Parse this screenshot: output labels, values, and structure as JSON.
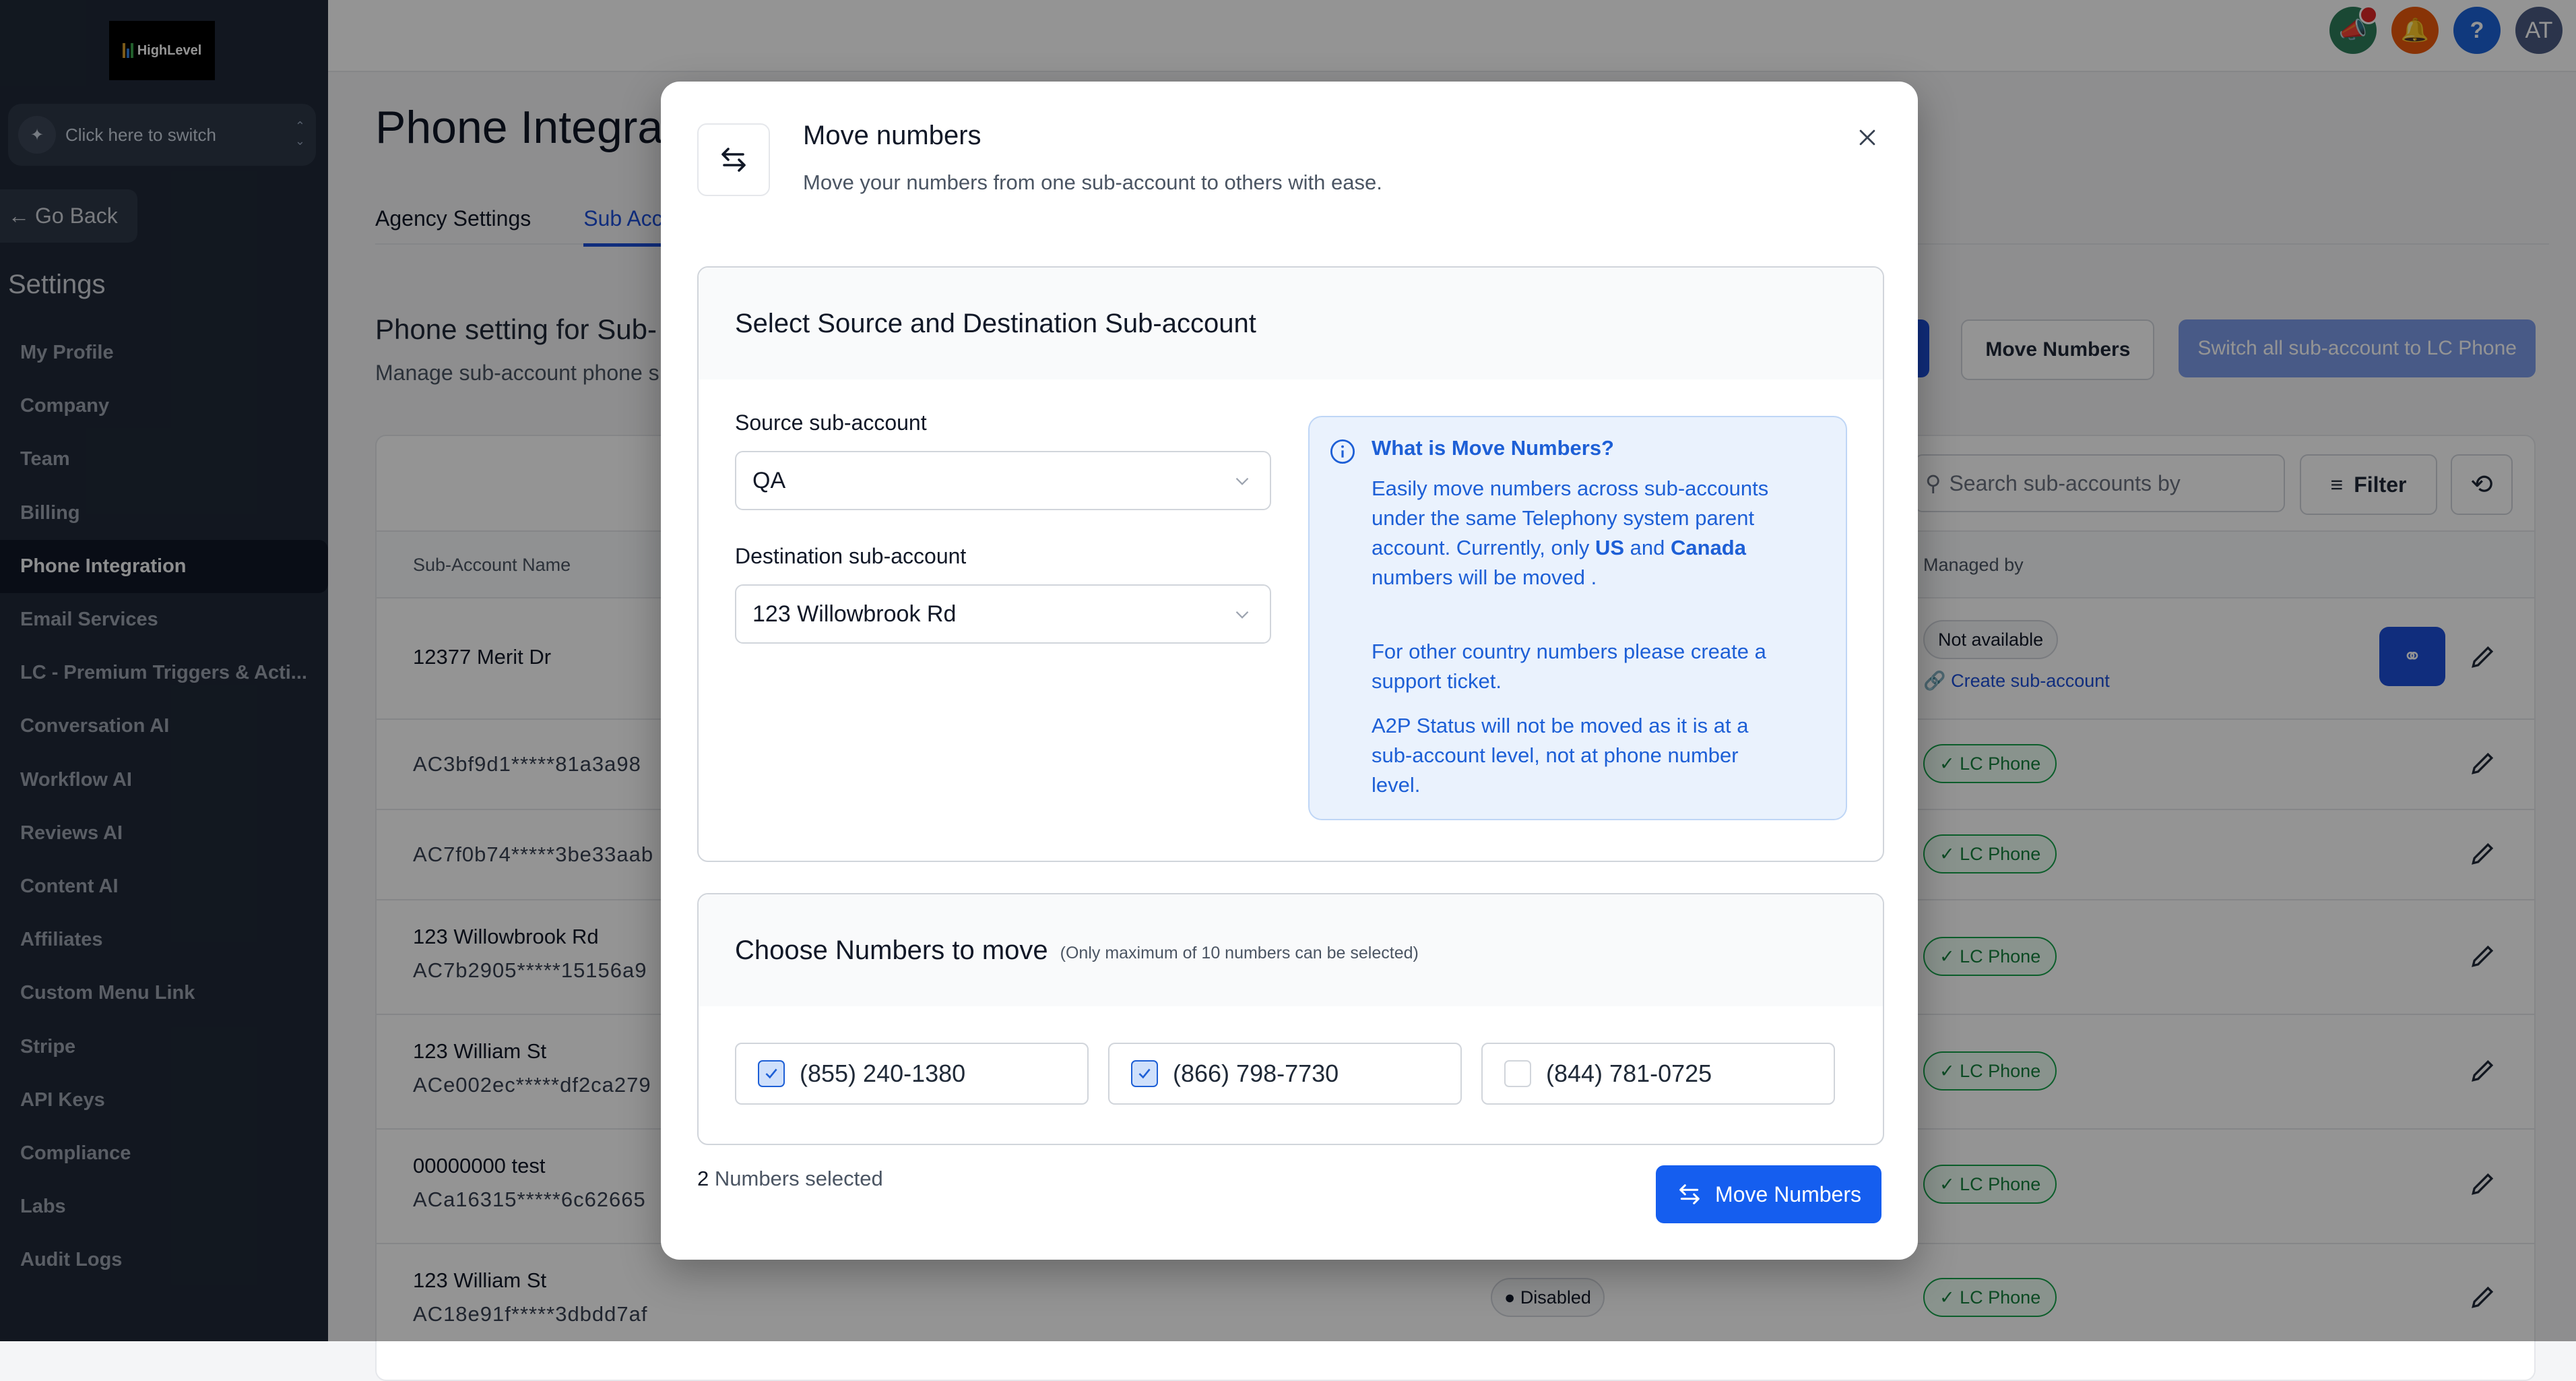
{
  "sidebar": {
    "logo_text": "HighLevel",
    "switcher_label": "Click here to switch",
    "go_back": "Go Back",
    "heading": "Settings",
    "items": [
      {
        "label": "My Profile",
        "active": false
      },
      {
        "label": "Company",
        "active": false
      },
      {
        "label": "Team",
        "active": false
      },
      {
        "label": "Billing",
        "active": false
      },
      {
        "label": "Phone Integration",
        "active": true
      },
      {
        "label": "Email Services",
        "active": false
      },
      {
        "label": "LC - Premium Triggers & Acti...",
        "active": false
      },
      {
        "label": "Conversation AI",
        "active": false
      },
      {
        "label": "Workflow AI",
        "active": false
      },
      {
        "label": "Reviews AI",
        "active": false
      },
      {
        "label": "Content AI",
        "active": false
      },
      {
        "label": "Affiliates",
        "active": false
      },
      {
        "label": "Custom Menu Link",
        "active": false
      },
      {
        "label": "Stripe",
        "active": false
      },
      {
        "label": "API Keys",
        "active": false
      },
      {
        "label": "Compliance",
        "active": false
      },
      {
        "label": "Labs",
        "active": false
      },
      {
        "label": "Audit Logs",
        "active": false
      }
    ]
  },
  "topbar": {
    "icons": [
      {
        "name": "megaphone-icon",
        "color": "#2e7d5b",
        "badge": true
      },
      {
        "name": "bell-icon",
        "color": "#ea580c",
        "badge": false
      },
      {
        "name": "help-icon",
        "color": "#1d63d8",
        "badge": false
      },
      {
        "name": "avatar",
        "color": "#4a5b82",
        "text": "AT"
      }
    ]
  },
  "page": {
    "title": "Phone Integra",
    "tabs": [
      {
        "label": "Agency Settings",
        "active": false
      },
      {
        "label": "Sub Acco",
        "active": true
      }
    ],
    "section_title": "Phone setting for Sub-",
    "section_desc": "Manage sub-account phone s",
    "buttons": {
      "move_numbers": "Move Numbers",
      "switch_all": "Switch all sub-account to LC Phone"
    },
    "search_placeholder": "Search sub-accounts by",
    "filter_label": "Filter",
    "table": {
      "headers": {
        "name": "Sub-Account Name",
        "managed_by": "Managed by"
      },
      "rows": [
        {
          "name": "12377 Merit Dr",
          "sid": "",
          "status": "",
          "managed": "Not available",
          "link": "Create sub-account"
        },
        {
          "name": "",
          "sid": "AC3bf9d1*****81a3a98",
          "status": "",
          "managed": "LC Phone"
        },
        {
          "name": "",
          "sid": "AC7f0b74*****3be33aab",
          "status": "",
          "managed": "LC Phone"
        },
        {
          "name": "123 Willowbrook Rd",
          "sid": "AC7b2905*****15156a9",
          "status": "",
          "managed": "LC Phone"
        },
        {
          "name": "123 William St",
          "sid": "ACe002ec*****df2ca279",
          "status": "",
          "managed": "LC Phone"
        },
        {
          "name": "00000000 test",
          "sid": "ACa16315*****6c62665",
          "status": "",
          "managed": "LC Phone"
        },
        {
          "name": "123 William St",
          "sid": "AC18e91f*****3dbdd7af",
          "status": "Disabled",
          "managed": "LC Phone"
        }
      ]
    }
  },
  "modal": {
    "title": "Move numbers",
    "subtitle": "Move your numbers from one sub-account to others with ease.",
    "source_section": {
      "title": "Select Source and Destination Sub-account",
      "source_label": "Source sub-account",
      "source_value": "QA",
      "dest_label": "Destination sub-account",
      "dest_value": "123 Willowbrook Rd"
    },
    "info": {
      "title": "What is Move Numbers?",
      "p1_a": "Easily move numbers across sub-accounts under the same Telephony system parent account. Currently, only ",
      "p1_us": "US",
      "p1_and": " and ",
      "p1_ca": "Canada",
      "p1_b": " numbers will be moved .",
      "p2": "For other country numbers please create a support ticket.",
      "p3": "A2P Status will not be moved as it is at a sub-account level, not at phone number level."
    },
    "numbers_section": {
      "title": "Choose Numbers to move",
      "note": "(Only maximum of 10 numbers can be selected)",
      "numbers": [
        {
          "number": "(855) 240-1380",
          "checked": true
        },
        {
          "number": "(866) 798-7730",
          "checked": true
        },
        {
          "number": "(844) 781-0725",
          "checked": false
        }
      ]
    },
    "selected_count": "2",
    "selected_label": " Numbers selected",
    "submit_label": "Move Numbers",
    "accent": "#155eef"
  }
}
